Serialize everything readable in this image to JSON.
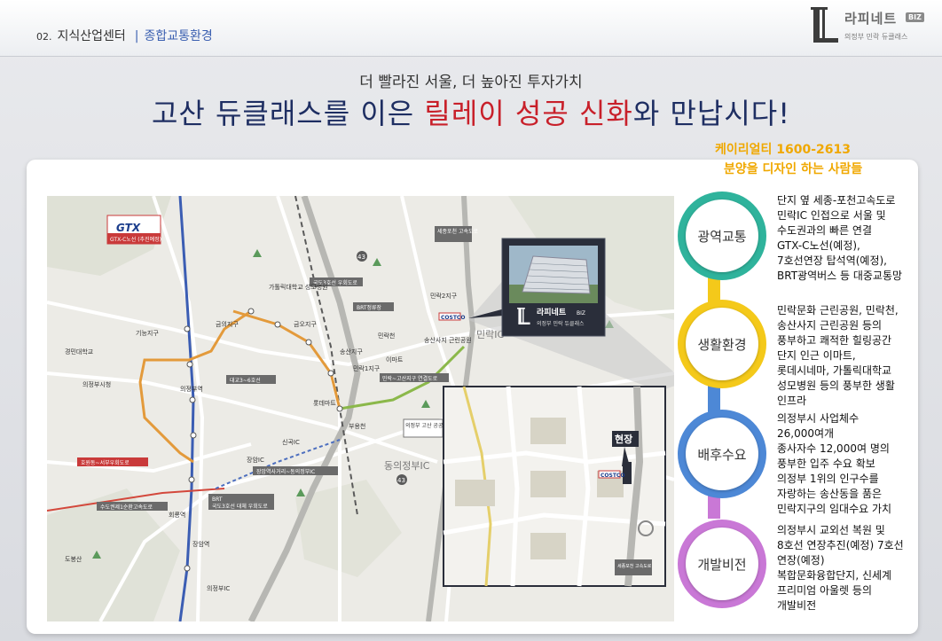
{
  "header": {
    "section_num": "02.",
    "section_title": "지식산업센터",
    "separator": "|",
    "subsection": "종합교통환경",
    "brand_name": "라피네트",
    "brand_badge": "BIZ",
    "brand_sub": "의정부 민락 듀클래스"
  },
  "headline": {
    "small": "더 빨라진 서울, 더 높아진 투자가치",
    "big_part1": "고산 듀클래스를 이은 ",
    "big_highlight": "릴레이 성공 신화",
    "big_part2": "와 만납시다!"
  },
  "contact": {
    "line1": "케이리얼티    1600-2613",
    "line2": "분양을 디자인 하는 사람들"
  },
  "map": {
    "gtx_label": "GTX",
    "gtx_sub": "GTX-C노선 (추진예정)",
    "building_name": "라피네트",
    "building_badge": "BIZ",
    "building_sub": "의정부 민락 듀클래스",
    "site_label": "현장",
    "costco": "COSTCO",
    "labels": {
      "minrak_ic": "민락IC",
      "dong_ic": "동의정부IC",
      "sejong_road": "세종포천 고속도로",
      "road3": "국도3호선 우회도로",
      "brt_station": "BRT정류장",
      "gosan_road": "민락~고산지구 연결도로",
      "uijeongbu_station": "의정부역",
      "songsan": "송산사지 근린공원",
      "catholic": "가톨릭대학교 성모병원",
      "geumoh": "금오지구",
      "geumui": "금의지구",
      "minrak2": "민락2지구",
      "minrak1": "민락1지구",
      "gosan_apt": "의정부 고산 공공주택지구",
      "hoeryong": "회룡역",
      "jangam": "장암역",
      "dobong": "도봉산",
      "daegyo": "대교3~6호선",
      "brt2": "BRT",
      "gukdo3": "국도3호선 대체 우회도로",
      "jangam_ic": "장암역사거리~동의정부IC",
      "hojwon": "호원동~서부우회도로",
      "sudo": "수도권제1순환고속도로",
      "kyungmin": "경민대학교",
      "city_hall": "의정부시청",
      "gineung": "기능지구",
      "lotte": "롯데마트",
      "emart": "이마트",
      "songsan2": "송산지구",
      "minrak_ch": "민락천",
      "buyong": "부용천",
      "sinchon": "신곡IC",
      "jangamic": "장암IC",
      "uijeongbu_ic": "의정부IC",
      "gosan_bus": "고산 버스",
      "route43": "43",
      "route_43b": "43"
    }
  },
  "features": [
    {
      "title": "광역교통",
      "color": "#2fb39c",
      "lines": [
        "단지 옆 세종-포천고속도로",
        "민락IC 인접으로 서울 및",
        "수도권과의 빠른 연결",
        "GTX-C노선(예정),",
        "7호선연장 탑석역(예정),",
        "BRT광역버스 등 대중교통망"
      ]
    },
    {
      "title": "생활환경",
      "color": "#f4c91a",
      "lines": [
        "민락문화 근린공원, 민락천,",
        "송산사지 근린공원 등의",
        "풍부하고 쾌적한 힐링공간",
        "단지 인근 이마트,",
        "롯데시네마, 가톨릭대학교",
        "성모병원 등의 풍부한 생활",
        "인프라"
      ]
    },
    {
      "title": "배후수요",
      "color": "#4d88d6",
      "lines": [
        "의정부시 사업체수",
        "26,000여개",
        "종사자수 12,000여 명의",
        "풍부한 입주 수요 확보",
        "의정부 1위의 인구수를",
        "자랑하는 송산동을 품은",
        "민락지구의 임대수요 가치"
      ]
    },
    {
      "title": "개발비전",
      "color": "#c978d6",
      "lines": [
        "의정부시 교외선 복원 및",
        "8호선 연장추진(예정) 7호선",
        "연장(예정)",
        "복합문화융합단지, 신세계",
        "프리미엄 아울렛 등의",
        "개발비전"
      ]
    }
  ]
}
